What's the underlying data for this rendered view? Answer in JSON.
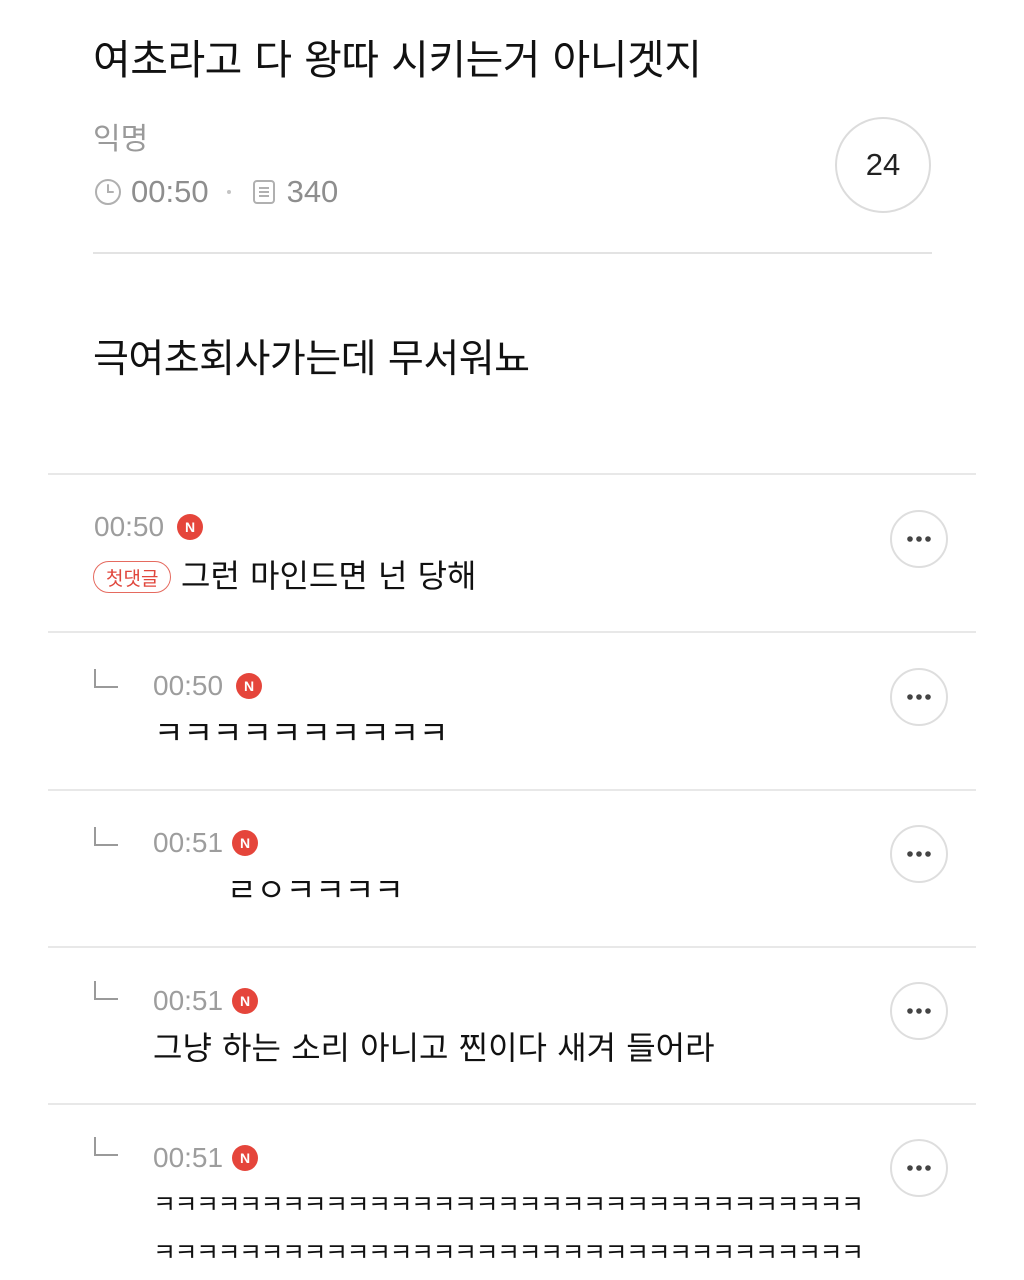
{
  "post": {
    "title": "여초라고 다 왕따 시키는거 아니겟지",
    "author": "익명",
    "time": "00:50",
    "views": "340",
    "comment_count": "24",
    "body": "극여초회사가는데 무서워뇨"
  },
  "colors": {
    "accent_red": "#e5453b",
    "muted_text": "#9d9d9d",
    "divider": "#e8e8e8"
  },
  "icons": {
    "time": "clock-icon",
    "views": "document-icon",
    "more": "more-dots-icon",
    "reply": "reply-arrow-icon",
    "new": "new-badge-icon"
  },
  "comments": [
    {
      "time": "00:50",
      "new_badge": "N",
      "first_badge": "첫댓글",
      "text": "그런 마인드면 넌 당해"
    },
    {
      "time": "00:50",
      "new_badge": "N",
      "text": "ㅋㅋㅋㅋㅋㅋㅋㅋㅋㅋ"
    },
    {
      "time": "00:51",
      "new_badge": "N",
      "text": "ㄹㅇㅋㅋㅋㅋ"
    },
    {
      "time": "00:51",
      "new_badge": "N",
      "text": "그냥 하는 소리 아니고 찐이다 새겨 들어라"
    },
    {
      "time": "00:51",
      "new_badge": "N",
      "text_line1": "ㅋㅋㅋㅋㅋㅋㅋㅋㅋㅋㅋㅋㅋㅋㅋㅋㅋㅋㅋㅋㅋㅋㅋㅋㅋㅋㅋㅋㅋㅋㅋㅋㅋ",
      "text_line2": "ㅋㅋㅋㅋㅋㅋㅋㅋㅋㅋㅋㅋㅋㅋㅋㅋㅋㅋㅋㅋㅋㅋㅋㅋㅋㅋㅋㅋㅋㅋㅋㅋㅋ"
    }
  ]
}
